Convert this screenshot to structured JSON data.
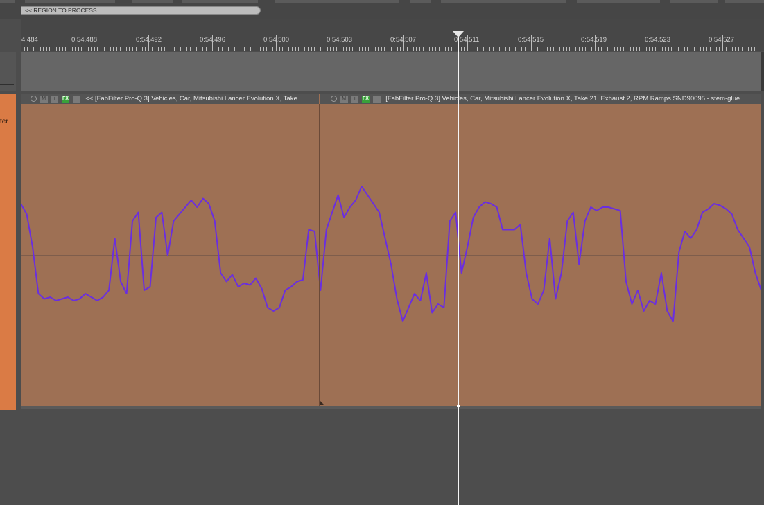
{
  "region": {
    "label": "<<  REGION TO PROCESS"
  },
  "ruler": {
    "ticks": [
      "4.484",
      "0:54.488",
      "0:54.492",
      "0:54.496",
      "0:54.500",
      "0:54.503",
      "0:54.507",
      "0:54.511",
      "0:54.515",
      "0:54.519",
      "0:54.523",
      "0:54.527"
    ]
  },
  "track": {
    "name_fragment": "ter"
  },
  "clips": [
    {
      "title": "<< [FabFilter Pro-Q 3] Vehicles, Car, Mitsubishi Lancer Evolution X, Take ...",
      "icons": {
        "mute": "M",
        "info": "i",
        "fx": "FX",
        "env": ""
      }
    },
    {
      "title": "[FabFilter Pro-Q 3] Vehicles, Car, Mitsubishi Lancer Evolution X, Take 21, Exhaust 2, RPM Ramps SND90095 - stem-glue",
      "icons": {
        "mute": "M",
        "info": "i",
        "fx": "FX",
        "env": ""
      }
    }
  ],
  "colors": {
    "track_header": "#da7b45",
    "clip_body": "#9e7054",
    "waveform": "#6a2ee0",
    "fx_badge": "#3aa13a"
  },
  "waveform": {
    "center_level": 0.0,
    "samples": [
      0.3,
      0.24,
      0.05,
      -0.22,
      -0.25,
      -0.24,
      -0.26,
      -0.25,
      -0.24,
      -0.26,
      -0.25,
      -0.22,
      -0.24,
      -0.26,
      -0.24,
      -0.2,
      0.1,
      -0.15,
      -0.22,
      0.2,
      0.25,
      -0.2,
      -0.18,
      0.22,
      0.25,
      0.0,
      0.2,
      0.24,
      0.28,
      0.32,
      0.28,
      0.33,
      0.3,
      0.2,
      -0.1,
      -0.15,
      -0.11,
      -0.18,
      -0.16,
      -0.17,
      -0.13,
      -0.19,
      -0.3,
      -0.32,
      -0.3,
      -0.2,
      -0.18,
      -0.15,
      -0.14,
      0.15,
      0.14,
      -0.2,
      0.15,
      0.25,
      0.35,
      0.22,
      0.28,
      0.32,
      0.4,
      0.35,
      0.3,
      0.25,
      0.1,
      -0.05,
      -0.25,
      -0.38,
      -0.3,
      -0.22,
      -0.26,
      -0.1,
      -0.33,
      -0.28,
      -0.3,
      0.2,
      0.25,
      -0.1,
      0.05,
      0.22,
      0.28,
      0.31,
      0.3,
      0.28,
      0.15,
      0.15,
      0.15,
      0.18,
      -0.1,
      -0.25,
      -0.28,
      -0.2,
      0.1,
      -0.25,
      -0.1,
      0.2,
      0.25,
      -0.05,
      0.2,
      0.28,
      0.26,
      0.28,
      0.28,
      0.27,
      0.26,
      -0.15,
      -0.28,
      -0.2,
      -0.32,
      -0.26,
      -0.28,
      -0.1,
      -0.32,
      -0.38,
      0.02,
      0.14,
      0.1,
      0.15,
      0.25,
      0.27,
      0.3,
      0.29,
      0.27,
      0.24,
      0.15,
      0.1,
      0.05,
      -0.1,
      -0.2
    ]
  }
}
